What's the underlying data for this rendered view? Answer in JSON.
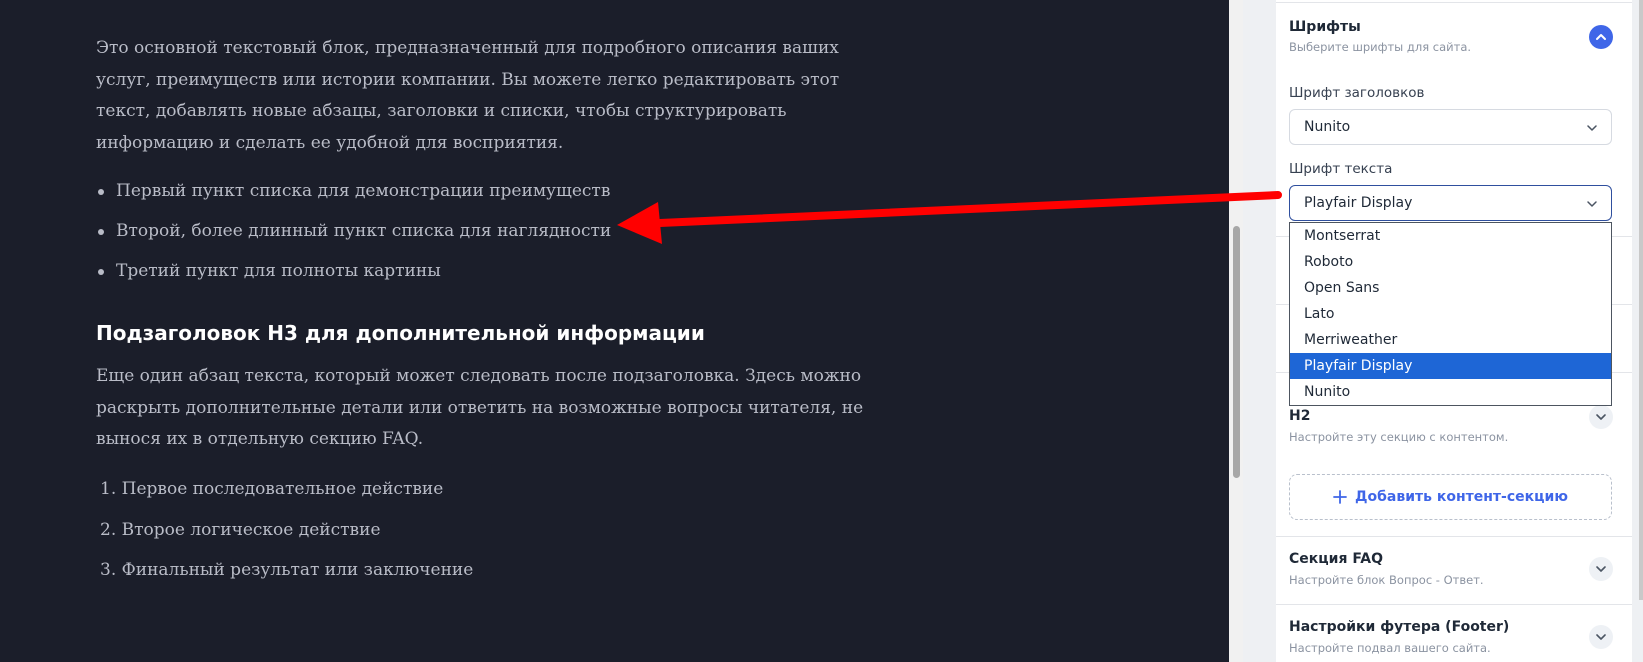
{
  "preview": {
    "intro": "Это основной текстовый блок, предназначенный для подробного описания ваших услуг, преимуществ или истории компании. Вы можете легко редактировать этот текст, добавлять новые абзацы, заголовки и списки, чтобы структурировать информацию и сделать ее удобной для восприятия.",
    "bullets": [
      "Первый пункт списка для демонстрации преимуществ",
      "Второй, более длинный пункт списка для наглядности",
      "Третий пункт для полноты картины"
    ],
    "subheading": "Подзаголовок H3 для дополнительной информации",
    "paragraph": "Еще один абзац текста, который может следовать после подзаголовка. Здесь можно раскрыть дополнительные детали или ответить на возможные вопросы читателя, не вынося их в отдельную секцию FAQ.",
    "ordered": [
      "1. Первое последовательное действие",
      "2. Второе логическое действие",
      "3. Финальный результат или заключение"
    ]
  },
  "panel": {
    "fonts": {
      "title": "Шрифты",
      "subtitle": "Выберите шрифты для сайта.",
      "heading_label": "Шрифт заголовков",
      "heading_value": "Nunito",
      "body_label": "Шрифт текста",
      "body_value": "Playfair Display",
      "options": [
        "Montserrat",
        "Roboto",
        "Open Sans",
        "Lato",
        "Merriweather",
        "Playfair Display",
        "Nunito"
      ],
      "selected_option": "Playfair Display"
    },
    "h2_section": {
      "title": "H2",
      "subtitle": "Настройте эту секцию с контентом."
    },
    "add_content_label": "Добавить контент-секцию",
    "faq": {
      "title": "Секция FAQ",
      "subtitle": "Настройте блок Вопрос - Ответ."
    },
    "footer": {
      "title": "Настройки футера (Footer)",
      "subtitle": "Настройте подвал вашего сайта."
    }
  },
  "colors": {
    "preview_bg": "#1b1e2a",
    "accent": "#3f66e8",
    "selected_option": "#1e66d6",
    "arrow": "#ff0000"
  }
}
